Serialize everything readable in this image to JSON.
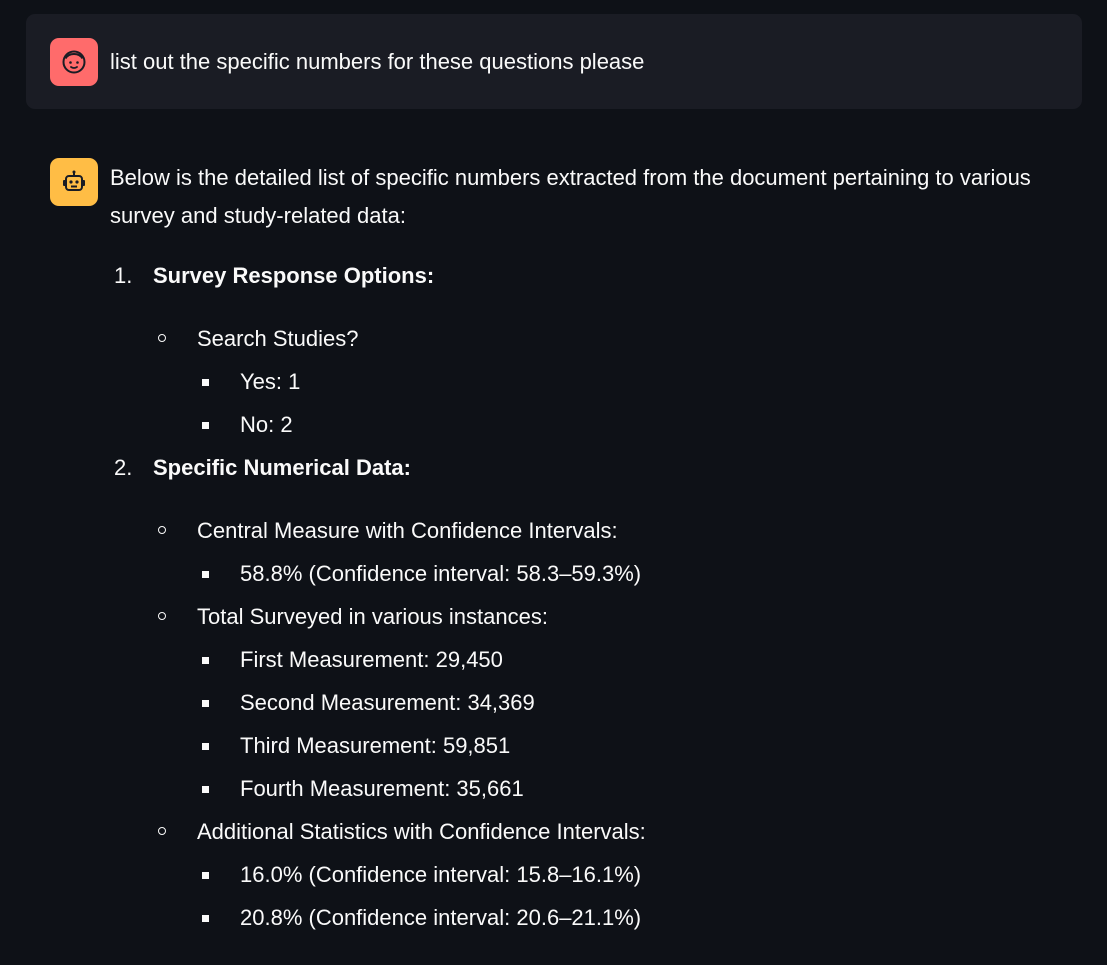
{
  "user_message": {
    "avatar_icon": "user-face-icon",
    "avatar_color": "#ff6b6b",
    "text": "list out the specific numbers for these questions please"
  },
  "assistant_message": {
    "avatar_icon": "robot-icon",
    "avatar_color": "#ffbd45",
    "intro": "Below is the detailed list of specific numbers extracted from the document pertaining to various survey and study-related data:",
    "sections": [
      {
        "number": "1.",
        "heading": "Survey Response Options:",
        "items": [
          {
            "label": "Search Studies?",
            "subitems": [
              "Yes: 1",
              "No: 2"
            ]
          }
        ]
      },
      {
        "number": "2.",
        "heading": "Specific Numerical Data:",
        "items": [
          {
            "label": "Central Measure with Confidence Intervals:",
            "subitems": [
              "58.8% (Confidence interval: 58.3–59.3%)"
            ]
          },
          {
            "label": "Total Surveyed in various instances:",
            "subitems": [
              "First Measurement: 29,450",
              "Second Measurement: 34,369",
              "Third Measurement: 59,851",
              "Fourth Measurement: 35,661"
            ]
          },
          {
            "label": "Additional Statistics with Confidence Intervals:",
            "subitems": [
              "16.0% (Confidence interval: 15.8–16.1%)",
              "20.8% (Confidence interval: 20.6–21.1%)"
            ]
          }
        ]
      }
    ]
  }
}
